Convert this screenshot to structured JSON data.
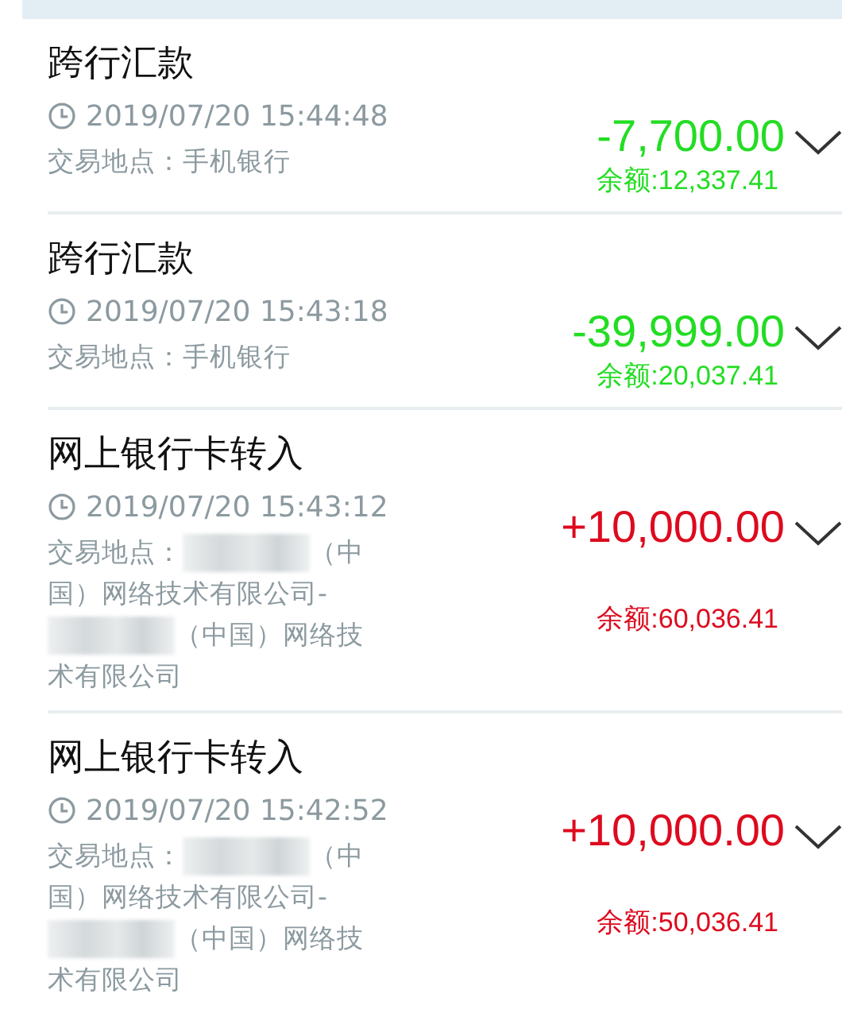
{
  "transactions": [
    {
      "title": "跨行汇款",
      "time": "2019/07/20 15:44:48",
      "kind": "expense",
      "color": "#22dd22",
      "amount": "-7,700.00",
      "balance": "余额:12,337.41",
      "location_lines": [
        [
          {
            "kind": "text",
            "text": "交易地点：手机银行"
          }
        ]
      ]
    },
    {
      "title": "跨行汇款",
      "time": "2019/07/20 15:43:18",
      "kind": "expense",
      "color": "#22dd22",
      "amount": "-39,999.00",
      "balance": "余额:20,037.41",
      "location_lines": [
        [
          {
            "kind": "text",
            "text": "交易地点：手机银行"
          }
        ]
      ]
    },
    {
      "title": "网上银行卡转入",
      "time": "2019/07/20 15:43:12",
      "kind": "income",
      "color": "#dd0a1e",
      "amount": "+10,000.00",
      "balance": "余额:60,036.41",
      "location_lines": [
        [
          {
            "kind": "text",
            "text": "交易地点："
          },
          {
            "kind": "redacted"
          },
          {
            "kind": "text",
            "text": "（中"
          }
        ],
        [
          {
            "kind": "text",
            "text": "国）网络技术有限公司-"
          }
        ],
        [
          {
            "kind": "redacted"
          },
          {
            "kind": "text",
            "text": "（中国）网络技"
          }
        ],
        [
          {
            "kind": "text",
            "text": "术有限公司"
          }
        ]
      ]
    },
    {
      "title": "网上银行卡转入",
      "time": "2019/07/20 15:42:52",
      "kind": "income",
      "color": "#dd0a1e",
      "amount": "+10,000.00",
      "balance": "余额:50,036.41",
      "location_lines": [
        [
          {
            "kind": "text",
            "text": "交易地点："
          },
          {
            "kind": "redacted"
          },
          {
            "kind": "text",
            "text": "（中"
          }
        ],
        [
          {
            "kind": "text",
            "text": "国）网络技术有限公司-"
          }
        ],
        [
          {
            "kind": "redacted"
          },
          {
            "kind": "text",
            "text": "（中国）网络技"
          }
        ],
        [
          {
            "kind": "text",
            "text": "术有限公司"
          }
        ]
      ]
    }
  ]
}
